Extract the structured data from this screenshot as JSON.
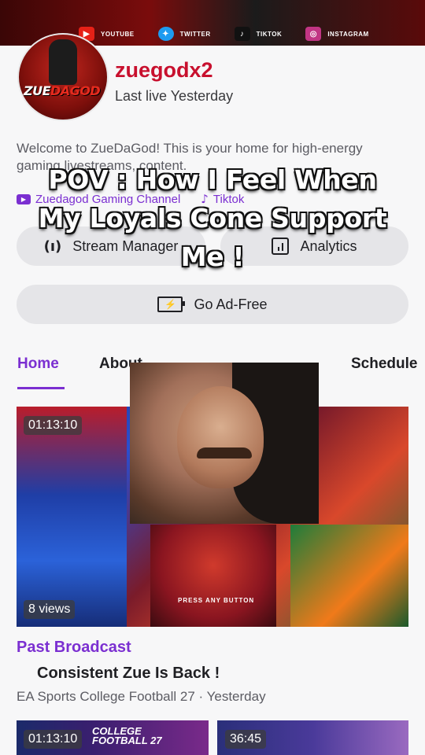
{
  "banner": {
    "socials": [
      {
        "label": "YOUTUBE",
        "icon": "youtube-icon",
        "color": "#e62117"
      },
      {
        "label": "TWITTER",
        "icon": "twitter-icon",
        "color": "#1d9bf0"
      },
      {
        "label": "TIKTOK",
        "icon": "tiktok-icon",
        "color": "#111111"
      },
      {
        "label": "INSTAGRAM",
        "icon": "instagram-icon",
        "color": "#c13584"
      }
    ]
  },
  "profile": {
    "avatar_logo_a": "ZUE",
    "avatar_logo_b": "DAGOD",
    "username": "zuegodx2",
    "last_live": "Last live Yesterday",
    "bio": "Welcome to ZueDaGod! This is your home for high-energy gaming livestreams, content.",
    "links": [
      {
        "label": "Zuedagod Gaming Channel",
        "icon": "youtube-icon"
      },
      {
        "label": "Tiktok",
        "icon": "tiktok-icon"
      }
    ]
  },
  "actions": {
    "stream_manager": "Stream Manager",
    "analytics": "Analytics",
    "go_ad_free": "Go Ad-Free"
  },
  "tabs": {
    "home": "Home",
    "about": "About",
    "schedule": "Schedule"
  },
  "featured": {
    "duration": "01:13:10",
    "views": "8 views",
    "press_any_button": "PRESS ANY BUTTON",
    "category_label": "Past Broadcast",
    "title": "Consistent Zue Is Back !",
    "subtitle": "EA Sports College Football 27 · Yesterday"
  },
  "thumbnails": [
    {
      "duration": "01:13:10",
      "art": "COLLEGE FOOTBALL 27"
    },
    {
      "duration": "36:45"
    }
  ],
  "caption": {
    "line1": "POV : How I Feel When",
    "line2": "My Loyals Cone Support",
    "line3": "Me !"
  },
  "colors": {
    "accent": "#7b2fd1",
    "username": "#c8102e"
  }
}
